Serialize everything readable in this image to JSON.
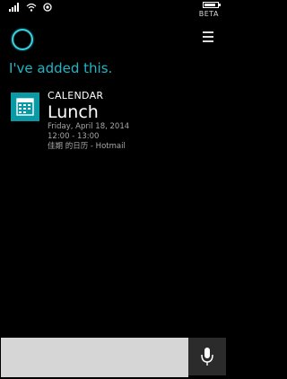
{
  "status_bar": {
    "signal_icons": [
      "signal-bars-icon",
      "wifi-icon",
      "alarm-icon"
    ],
    "battery_icon": "battery-icon",
    "beta_label": "BETA"
  },
  "header": {
    "assistant_icon": "cortana-ring-icon",
    "menu_icon": "hamburger-menu-icon"
  },
  "message": "I've added this.",
  "card": {
    "icon": "calendar-icon",
    "app_name": "CALENDAR",
    "event_title": "Lunch",
    "date": "Friday, April 18, 2014",
    "time": "12:00 - 13:00",
    "calendar_source": "佳期 的日历 - Hotmail"
  },
  "input": {
    "value": "",
    "placeholder": "",
    "mic_icon": "microphone-icon"
  },
  "colors": {
    "accent": "#1fb6c6",
    "tile": "#0a9aa5",
    "background": "#000000"
  }
}
